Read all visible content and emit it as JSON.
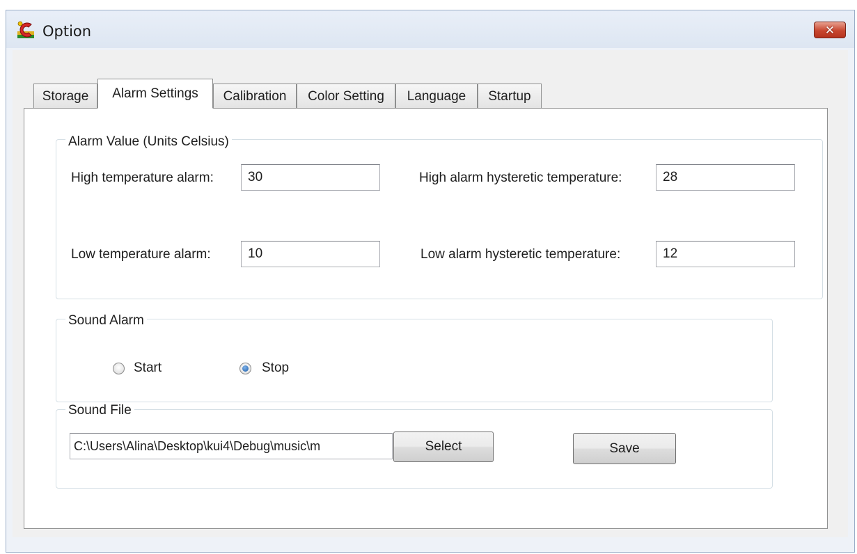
{
  "window": {
    "title": "Option",
    "close_symbol": "✕",
    "app_icon": "app-logo-icon",
    "close_icon": "close-icon"
  },
  "tabs": [
    {
      "label": "Storage",
      "active": false
    },
    {
      "label": "Alarm Settings",
      "active": true
    },
    {
      "label": "Calibration",
      "active": false
    },
    {
      "label": "Color Setting",
      "active": false
    },
    {
      "label": "Language",
      "active": false
    },
    {
      "label": "Startup",
      "active": false
    }
  ],
  "alarm_value": {
    "title": "Alarm Value (Units Celsius)",
    "high_temp_label": "High temperature alarm:",
    "high_temp_value": "30",
    "low_temp_label": "Low temperature alarm:",
    "low_temp_value": "10",
    "high_hyst_label": "High alarm hysteretic temperature:",
    "high_hyst_value": "28",
    "low_hyst_label": "Low alarm hysteretic temperature:",
    "low_hyst_value": "12"
  },
  "sound_alarm": {
    "title": "Sound Alarm",
    "options": [
      {
        "label": "Start",
        "checked": false
      },
      {
        "label": "Stop",
        "checked": true
      }
    ]
  },
  "sound_file": {
    "title": "Sound File",
    "path_value": "C:\\Users\\Alina\\Desktop\\kui4\\Debug\\music\\m",
    "select_label": "Select",
    "save_label": "Save"
  },
  "colors": {
    "window_frame": "#9aaec8",
    "close_button": "#c8462f",
    "radio_checked": "#1e5ea8"
  }
}
